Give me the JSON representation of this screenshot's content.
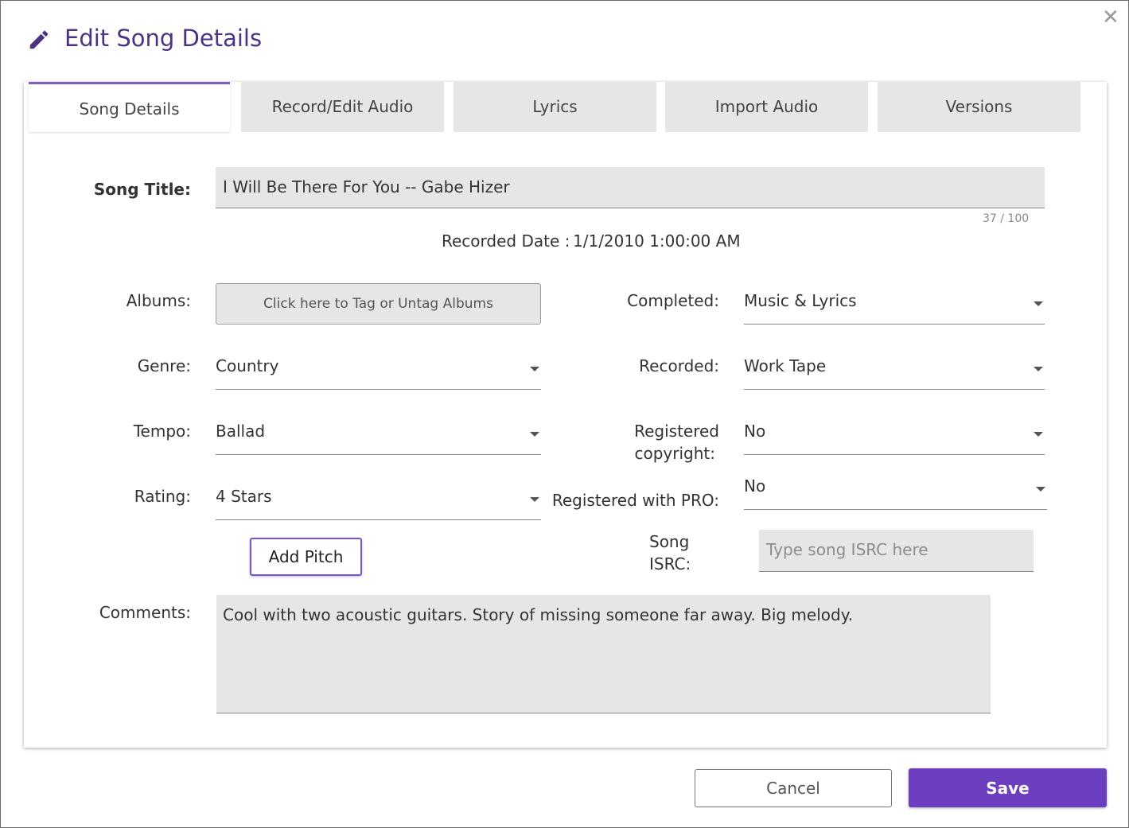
{
  "dialog": {
    "title": "Edit Song Details",
    "close_icon": "close-icon",
    "title_icon": "pencil-icon"
  },
  "tabs": [
    {
      "label": "Song Details",
      "active": true
    },
    {
      "label": "Record/Edit Audio",
      "active": false
    },
    {
      "label": "Lyrics",
      "active": false
    },
    {
      "label": "Import Audio",
      "active": false
    },
    {
      "label": "Versions",
      "active": false
    }
  ],
  "form": {
    "song_title": {
      "label": "Song Title:",
      "value": "I Will Be There For You -- Gabe Hizer",
      "counter": "37 / 100"
    },
    "recorded_date": {
      "label": "Recorded Date :",
      "value": "1/1/2010 1:00:00 AM"
    },
    "albums": {
      "label": "Albums:",
      "button_label": "Click here to Tag or Untag Albums"
    },
    "genre": {
      "label": "Genre:",
      "value": "Country"
    },
    "tempo": {
      "label": "Tempo:",
      "value": "Ballad"
    },
    "rating": {
      "label": "Rating:",
      "value": "4 Stars"
    },
    "completed": {
      "label": "Completed:",
      "value": "Music & Lyrics"
    },
    "recorded": {
      "label": "Recorded:",
      "value": "Work Tape"
    },
    "registered_copyright": {
      "label_line1": "Registered",
      "label_line2": "copyright:",
      "value": "No"
    },
    "registered_pro": {
      "label": "Registered with PRO:",
      "value": "No"
    },
    "isrc": {
      "label_line1": "Song",
      "label_line2": "ISRC:",
      "value": "",
      "placeholder": "Type song ISRC here"
    },
    "add_pitch": "Add Pitch",
    "comments": {
      "label": "Comments:",
      "value": "Cool with two acoustic guitars. Story of missing someone far away. Big melody."
    }
  },
  "footer": {
    "cancel_label": "Cancel",
    "save_label": "Save"
  },
  "colors": {
    "accent": "#6b3fc0",
    "title": "#4b3382",
    "field_bg": "#e6e6e6"
  }
}
